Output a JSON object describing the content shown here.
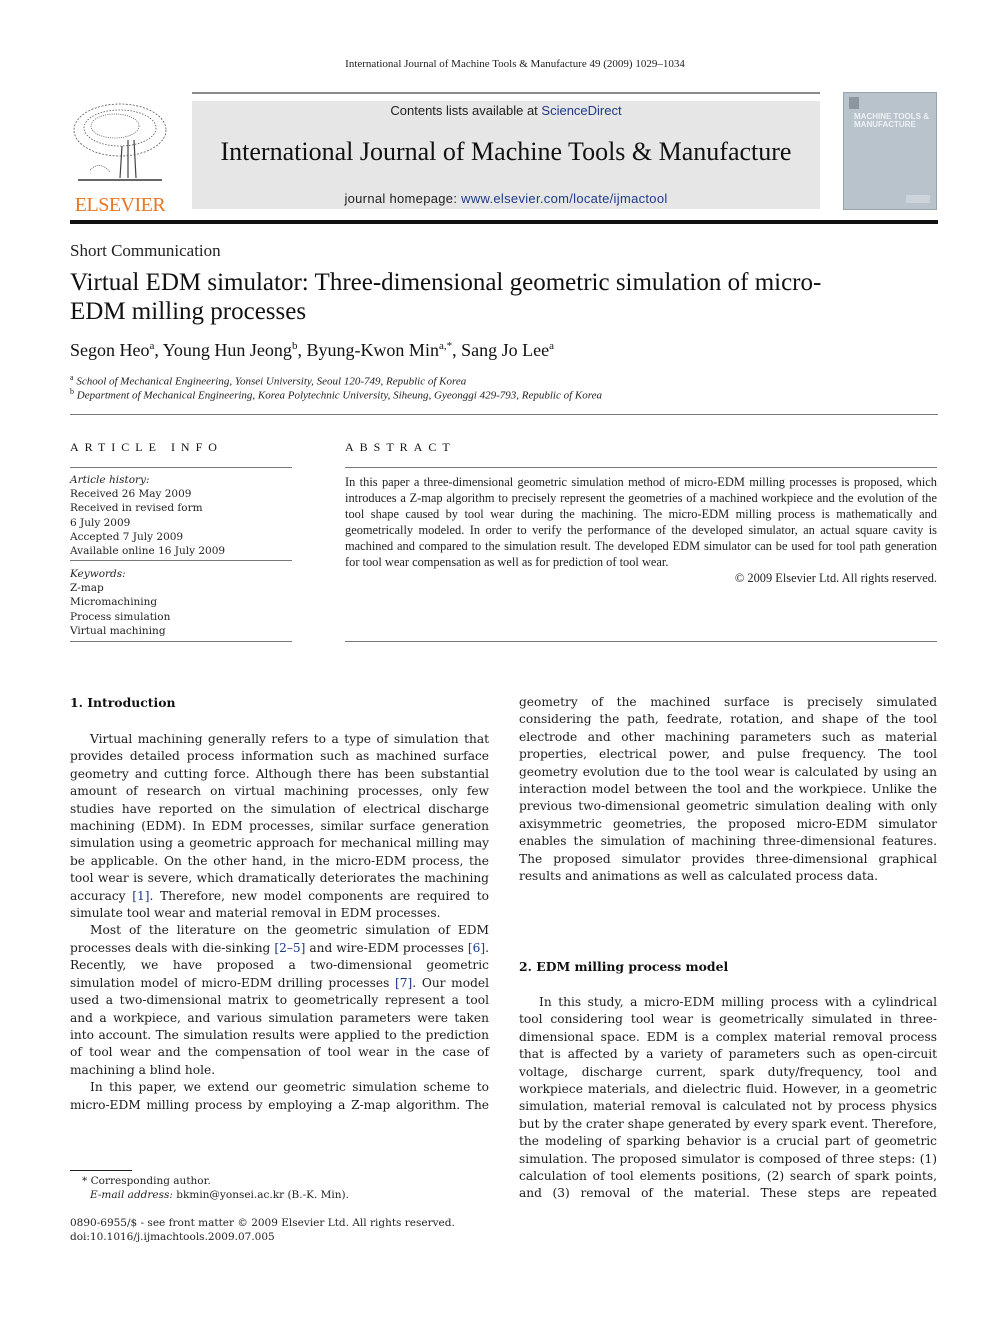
{
  "running_head": "International Journal of Machine Tools & Manufacture 49 (2009) 1029–1034",
  "masthead": {
    "contents_prefix": "Contents lists available at ",
    "contents_link": "ScienceDirect",
    "journal_title": "International Journal of Machine Tools & Manufacture",
    "homepage_prefix": "journal homepage: ",
    "homepage_link": "www.elsevier.com/locate/ijmactool",
    "publisher_logo_text": "ELSEVIER",
    "cover_title": "MACHINE TOOLS & MANUFACTURE",
    "accent_color": "#e87722",
    "link_color": "#1f3a8a"
  },
  "article": {
    "type": "Short Communication",
    "title": "Virtual EDM simulator: Three-dimensional geometric simulation of micro-EDM milling processes",
    "authors": [
      {
        "name": "Segon Heo",
        "sup": "a"
      },
      {
        "name": "Young Hun Jeong",
        "sup": "b"
      },
      {
        "name": "Byung-Kwon Min",
        "sup": "a,*"
      },
      {
        "name": "Sang Jo Lee",
        "sup": "a"
      }
    ],
    "affiliations": [
      {
        "sup": "a",
        "text": "School of Mechanical Engineering, Yonsei University, Seoul 120-749, Republic of Korea"
      },
      {
        "sup": "b",
        "text": "Department of Mechanical Engineering, Korea Polytechnic University, Siheung, Gyeonggi 429-793, Republic of Korea"
      }
    ]
  },
  "article_info": {
    "heading": "ARTICLE INFO",
    "history_label": "Article history:",
    "history": [
      "Received 26 May 2009",
      "Received in revised form",
      "6 July 2009",
      "Accepted 7 July 2009",
      "Available online 16 July 2009"
    ],
    "keywords_label": "Keywords:",
    "keywords": [
      "Z-map",
      "Micromachining",
      "Process simulation",
      "Virtual machining"
    ]
  },
  "abstract": {
    "heading": "ABSTRACT",
    "text": "In this paper a three-dimensional geometric simulation method of micro-EDM milling processes is proposed, which introduces a Z-map algorithm to precisely represent the geometries of a machined workpiece and the evolution of the tool shape caused by tool wear during the machining. The micro-EDM milling process is mathematically and geometrically modeled. In order to verify the performance of the developed simulator, an actual square cavity is machined and compared to the simulation result. The developed EDM simulator can be used for tool path generation for tool wear compensation as well as for prediction of tool wear.",
    "copyright": "© 2009 Elsevier Ltd. All rights reserved."
  },
  "sections": {
    "intro": {
      "heading": "1.  Introduction",
      "p1_a": "Virtual machining generally refers to a type of simulation that provides detailed process information such as machined surface geometry and cutting force. Although there has been substantial amount of research on virtual machining processes, only few studies have reported on the simulation of electrical discharge machining (EDM). In EDM processes, similar surface generation simulation using a geometric approach for mechanical milling may be applicable. On the other hand, in the micro-EDM process, the tool wear is severe, which dramatically deteriorates the machining accuracy ",
      "p1_ref1": "[1]",
      "p1_b": ". Therefore, new model components are required to simulate tool wear and material removal in EDM processes.",
      "p2_a": "Most of the literature on the geometric simulation of EDM processes deals with die-sinking ",
      "p2_ref1": "[2–5]",
      "p2_b": " and wire-EDM processes ",
      "p2_ref2": "[6]",
      "p2_c": ". Recently, we have proposed a two-dimensional geometric simulation model of micro-EDM drilling processes ",
      "p2_ref3": "[7]",
      "p2_d": ". Our model used a two-dimensional matrix to geometrically represent a tool and a workpiece, and various simulation parameters were taken into account. The simulation results were applied to the prediction of tool wear and the compensation of tool wear in the case of machining a blind hole.",
      "p3": "In this paper, we extend our geometric simulation scheme to micro-EDM milling process by employing a Z-map algorithm. The",
      "p3_cont": "geometry of the machined surface is precisely simulated considering the path, feedrate, rotation, and shape of the tool electrode and other machining parameters such as material properties, electrical power, and pulse frequency. The tool geometry evolution due to the tool wear is calculated by using an interaction model between the tool and the workpiece. Unlike the previous two-dimensional geometric simulation dealing with only axisymmetric geometries, the proposed micro-EDM simulator enables the simulation of machining three-dimensional features. The proposed simulator provides three-dimensional graphical results and animations as well as calculated process data."
    },
    "model": {
      "heading": "2.  EDM milling process model",
      "p1": "In this study, a micro-EDM milling process with a cylindrical tool considering tool wear is geometrically simulated in three-dimensional space. EDM is a complex material removal process that is affected by a variety of parameters such as open-circuit voltage, discharge current, spark duty/frequency, tool and workpiece materials, and dielectric fluid. However, in a geometric simulation, material removal is calculated not by process physics but by the crater shape generated by every spark event. Therefore, the modeling of sparking behavior is a crucial part of geometric simulation. The proposed simulator is composed of three steps: (1) calculation of tool elements positions, (2) search of spark points, and (3) removal of the material. These steps are repeated"
    }
  },
  "footnotes": {
    "corresponding": "* Corresponding author.",
    "email_label": "E-mail address:",
    "email": " bkmin@yonsei.ac.kr (B.-K. Min).",
    "issn": "0890-6955/$ - see front matter © 2009 Elsevier Ltd. All rights reserved.",
    "doi": "doi:10.1016/j.ijmachtools.2009.07.005"
  }
}
